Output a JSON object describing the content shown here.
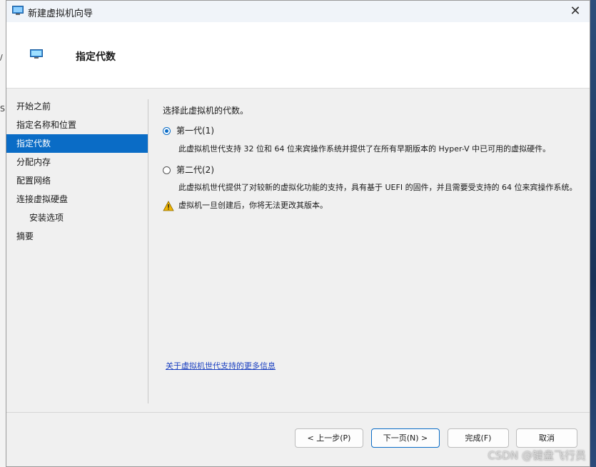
{
  "window": {
    "title": "新建虚拟机向导",
    "close_glyph": "✕"
  },
  "header": {
    "title": "指定代数"
  },
  "nav": {
    "items": [
      {
        "label": "开始之前"
      },
      {
        "label": "指定名称和位置"
      },
      {
        "label": "指定代数",
        "active": true
      },
      {
        "label": "分配内存"
      },
      {
        "label": "配置网络"
      },
      {
        "label": "连接虚拟硬盘"
      },
      {
        "label": "安装选项",
        "sub": true
      },
      {
        "label": "摘要"
      }
    ]
  },
  "content": {
    "prompt": "选择此虚拟机的代数。",
    "gen1": {
      "label": "第一代(1)",
      "selected": true,
      "desc": "此虚拟机世代支持 32 位和 64 位来宾操作系统并提供了在所有早期版本的 Hyper-V 中已可用的虚拟硬件。"
    },
    "gen2": {
      "label": "第二代(2)",
      "selected": false,
      "desc": "此虚拟机世代提供了对较新的虚拟化功能的支持，具有基于 UEFI 的固件，并且需要受支持的 64 位来宾操作系统。"
    },
    "warning": "虚拟机一旦创建后，你将无法更改其版本。",
    "more_info_link": "关于虚拟机世代支持的更多信息"
  },
  "buttons": {
    "prev": "< 上一步(P)",
    "next": "下一页(N) >",
    "finish": "完成(F)",
    "cancel": "取消"
  },
  "background": {
    "left_fragments": [
      "/",
      "S"
    ]
  },
  "watermark": "CSDN @键盘飞行员",
  "colors": {
    "accent": "#0a6cc6",
    "link": "#1a3fc0",
    "warning": "#f0b400"
  }
}
